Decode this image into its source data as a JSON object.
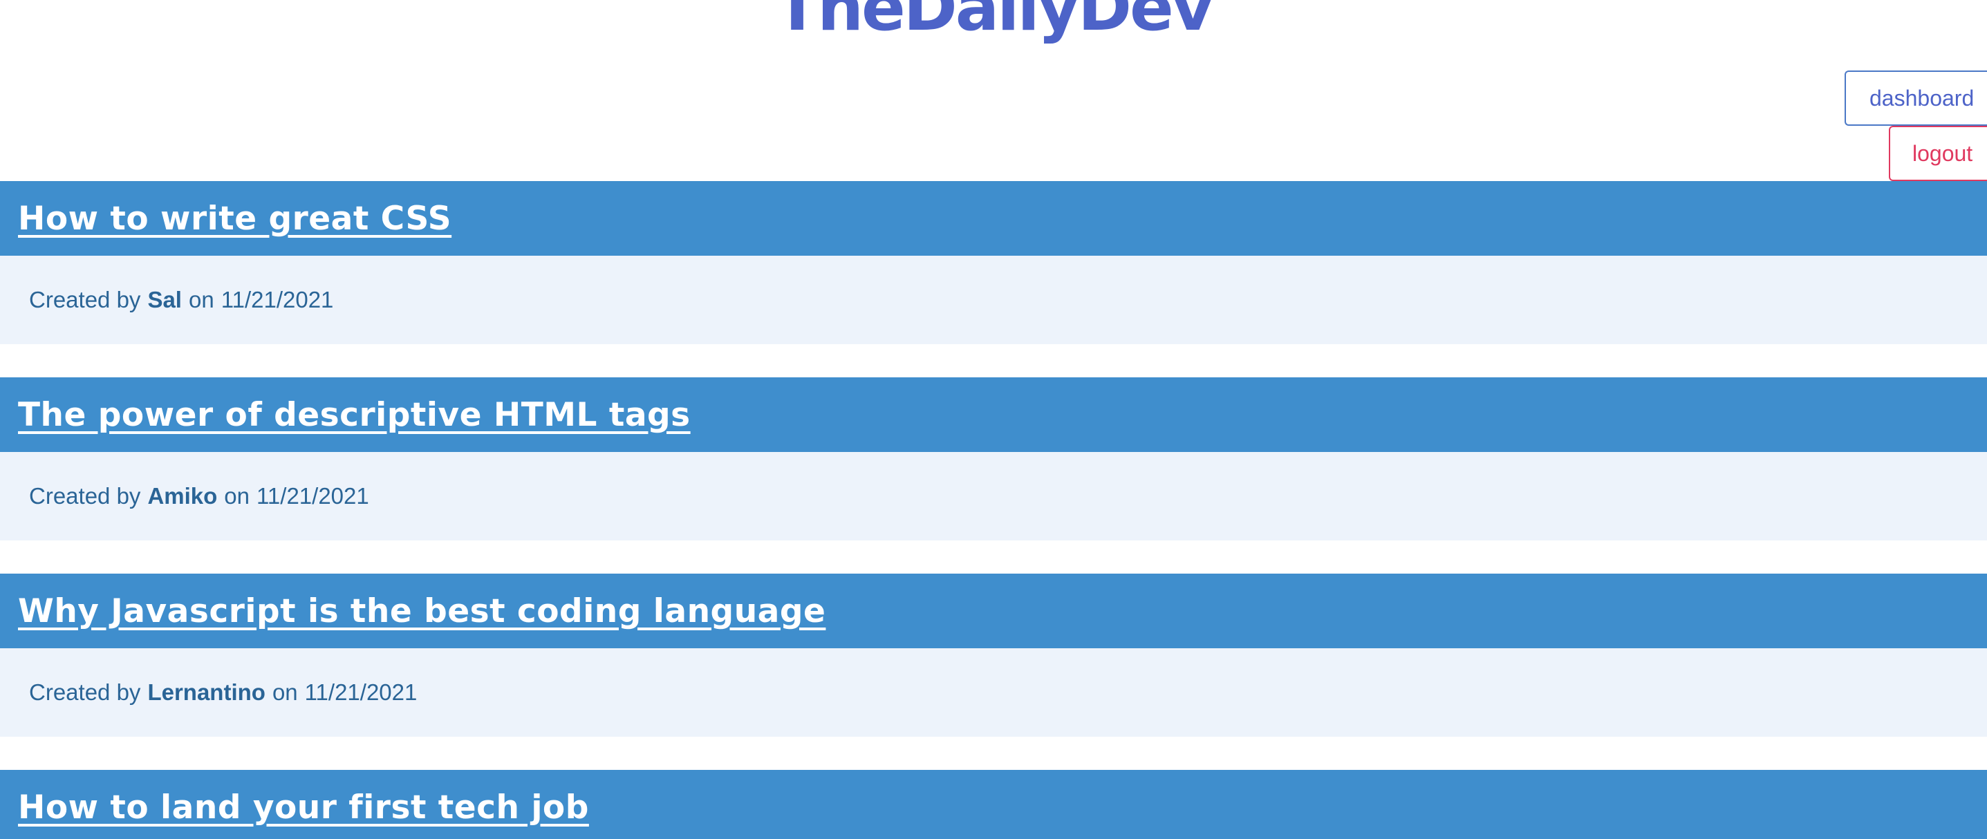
{
  "header": {
    "site_title": "TheDailyDev",
    "dashboard_label": "dashboard",
    "logout_label": "logout"
  },
  "meta_text": {
    "created_by": "Created by",
    "on": "on"
  },
  "posts": [
    {
      "title": "How to write great CSS",
      "author": "Sal",
      "date": "11/21/2021"
    },
    {
      "title": "The power of descriptive HTML tags",
      "author": "Amiko",
      "date": "11/21/2021"
    },
    {
      "title": "Why Javascript is the best coding language",
      "author": "Lernantino",
      "date": "11/21/2021"
    },
    {
      "title": "How to land your first tech job"
    }
  ],
  "colors": {
    "title": "#4d63c8",
    "post_header_bg": "#3f8ecd",
    "post_meta_bg": "#edf3fb",
    "meta_text": "#2a6496",
    "dashboard_accent": "#4a78c6",
    "logout_accent": "#e0395f"
  }
}
